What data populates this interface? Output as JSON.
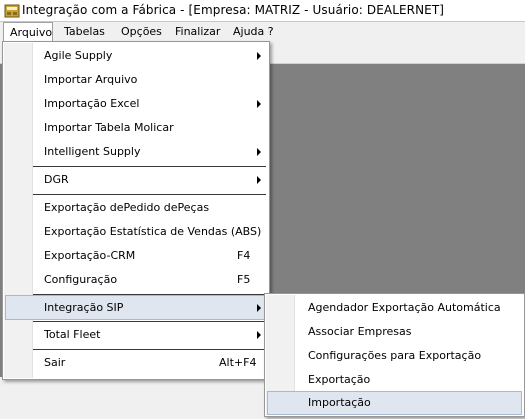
{
  "window": {
    "title": "Integração com a Fábrica - [Empresa: MATRIZ - Usuário: DEALERNET]",
    "icon": "app-icon"
  },
  "menubar": [
    {
      "label": "Arquivo",
      "active": true
    },
    {
      "label": "Tabelas",
      "active": false
    },
    {
      "label": "Opções",
      "active": false
    },
    {
      "label": "Finalizar",
      "active": false
    },
    {
      "label": "Ajuda ?",
      "active": false
    }
  ],
  "arquivo_menu": {
    "items": [
      {
        "label": "Agile Supply",
        "submenu": true,
        "shortcut": ""
      },
      {
        "label": "Importar Arquivo",
        "submenu": false,
        "shortcut": ""
      },
      {
        "label": "Importação Excel",
        "submenu": true,
        "shortcut": ""
      },
      {
        "label": "Importar Tabela Molicar",
        "submenu": false,
        "shortcut": ""
      },
      {
        "label": "Intelligent Supply",
        "submenu": true,
        "shortcut": ""
      },
      {
        "label": "DGR",
        "submenu": true,
        "shortcut": ""
      },
      {
        "label": "Exportação dePedido dePeças",
        "submenu": false,
        "shortcut": ""
      },
      {
        "label": "Exportação Estatística de Vendas (ABS)",
        "submenu": false,
        "shortcut": ""
      },
      {
        "label": "Exportação-CRM",
        "submenu": false,
        "shortcut": "F4"
      },
      {
        "label": "Configuração",
        "submenu": false,
        "shortcut": "F5"
      },
      {
        "label": "Integração SIP",
        "submenu": true,
        "shortcut": "",
        "highlighted": true
      },
      {
        "label": "Total Fleet",
        "submenu": true,
        "shortcut": ""
      },
      {
        "label": "Sair",
        "submenu": false,
        "shortcut": "Alt+F4"
      }
    ]
  },
  "sip_submenu": {
    "items": [
      {
        "label": "Agendador Exportação Automática"
      },
      {
        "label": "Associar Empresas"
      },
      {
        "label": "Configurações para Exportação"
      },
      {
        "label": "Exportação"
      },
      {
        "label": "Importação",
        "highlighted": true
      }
    ]
  },
  "colors": {
    "highlight": "#dfe6ef",
    "highlight_border": "#a8b8cf",
    "workspace": "#808080"
  }
}
